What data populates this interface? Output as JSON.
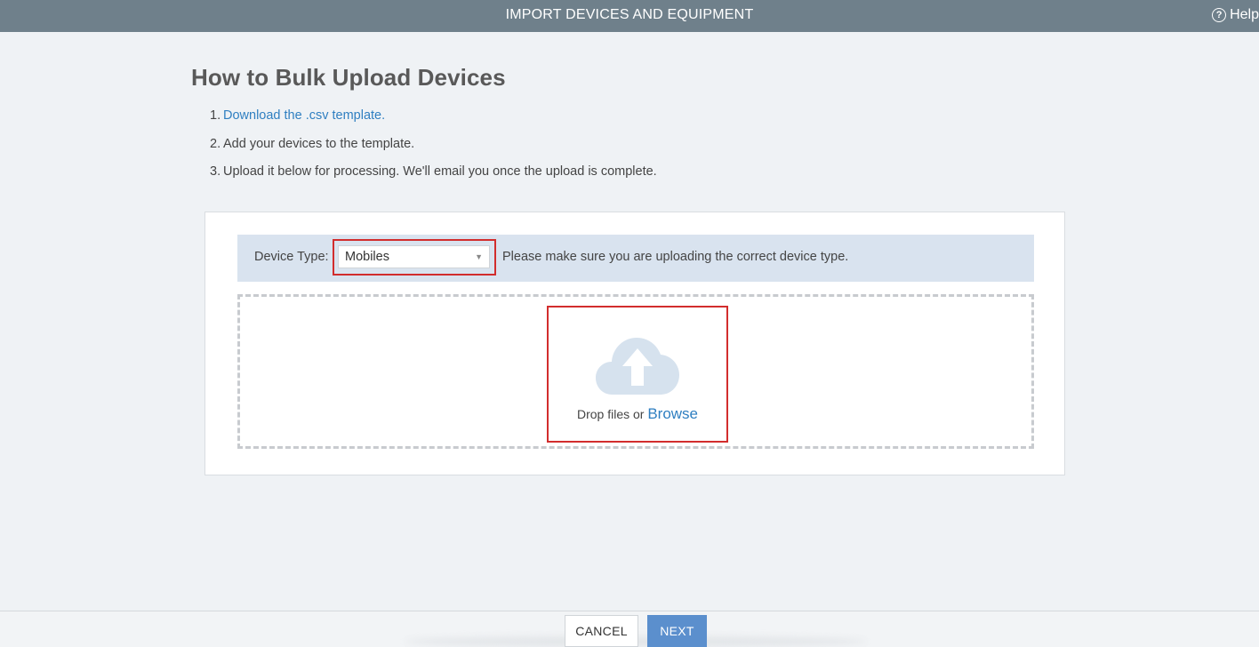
{
  "header": {
    "title": "IMPORT DEVICES AND EQUIPMENT",
    "help_label": "Help",
    "help_icon": "question-circle-icon"
  },
  "main": {
    "heading": "How to Bulk Upload Devices",
    "steps": [
      {
        "number": "1.",
        "text": "Download the .csv template."
      },
      {
        "number": "2.",
        "text": "Add your devices to the template."
      },
      {
        "number": "3.",
        "text": "Upload it below for processing. We'll email you once the upload is complete."
      }
    ]
  },
  "upload_card": {
    "device_type_label": "Device Type:",
    "device_type_value": "Mobiles",
    "device_type_note": "Please make sure you are uploading the correct device type.",
    "dropzone": {
      "icon": "cloud-upload-icon",
      "text": "Drop files or",
      "browse_label": "Browse"
    }
  },
  "footer": {
    "cancel_label": "CANCEL",
    "next_label": "NEXT"
  },
  "colors": {
    "header_bg": "#6f808b",
    "page_bg": "#eff2f5",
    "link": "#2f7fc1",
    "highlight_border": "#d22d2d",
    "type_bar_bg": "#d9e3ef",
    "primary_button": "#5b8fcd",
    "cloud_icon": "#d6e2ee"
  }
}
